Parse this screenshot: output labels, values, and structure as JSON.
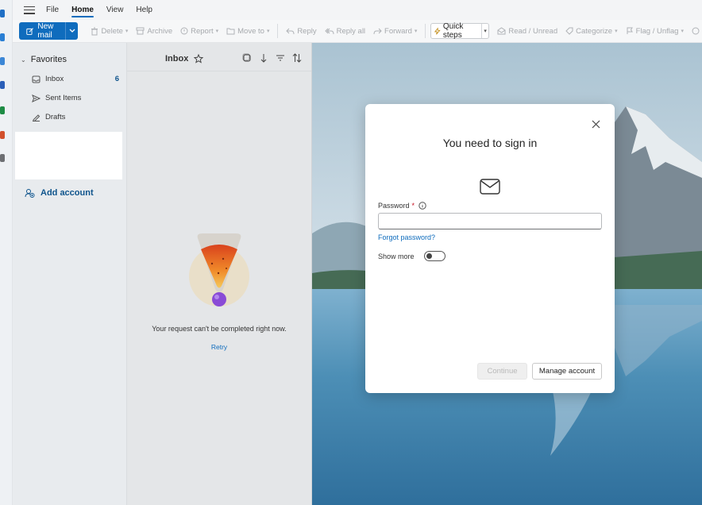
{
  "menubar": {
    "tabs": [
      {
        "label": "File"
      },
      {
        "label": "Home"
      },
      {
        "label": "View"
      },
      {
        "label": "Help"
      }
    ]
  },
  "ribbon": {
    "new_mail": "New mail",
    "delete": "Delete",
    "archive": "Archive",
    "report": "Report",
    "move_to": "Move to",
    "reply": "Reply",
    "reply_all": "Reply all",
    "forward": "Forward",
    "quick_steps": "Quick steps",
    "read_unread": "Read / Unread",
    "categorize": "Categorize",
    "flag_unflag": "Flag / Unflag"
  },
  "folders": {
    "favorites": "Favorites",
    "items": [
      {
        "label": "Inbox",
        "count": "6"
      },
      {
        "label": "Sent Items",
        "count": ""
      },
      {
        "label": "Drafts",
        "count": ""
      }
    ],
    "add_account": "Add account"
  },
  "message_list": {
    "title": "Inbox",
    "error_message": "Your request can't be completed right now.",
    "retry": "Retry"
  },
  "dialog": {
    "title": "You need to sign in",
    "password_label": "Password",
    "required_mark": "*",
    "password_value": "",
    "forgot_password": "Forgot password?",
    "show_more": "Show more",
    "show_more_on": false,
    "continue": "Continue",
    "manage_account": "Manage account"
  },
  "colors": {
    "accent": "#0f6cbd",
    "link": "#0f548c",
    "required": "#c50f1f"
  }
}
